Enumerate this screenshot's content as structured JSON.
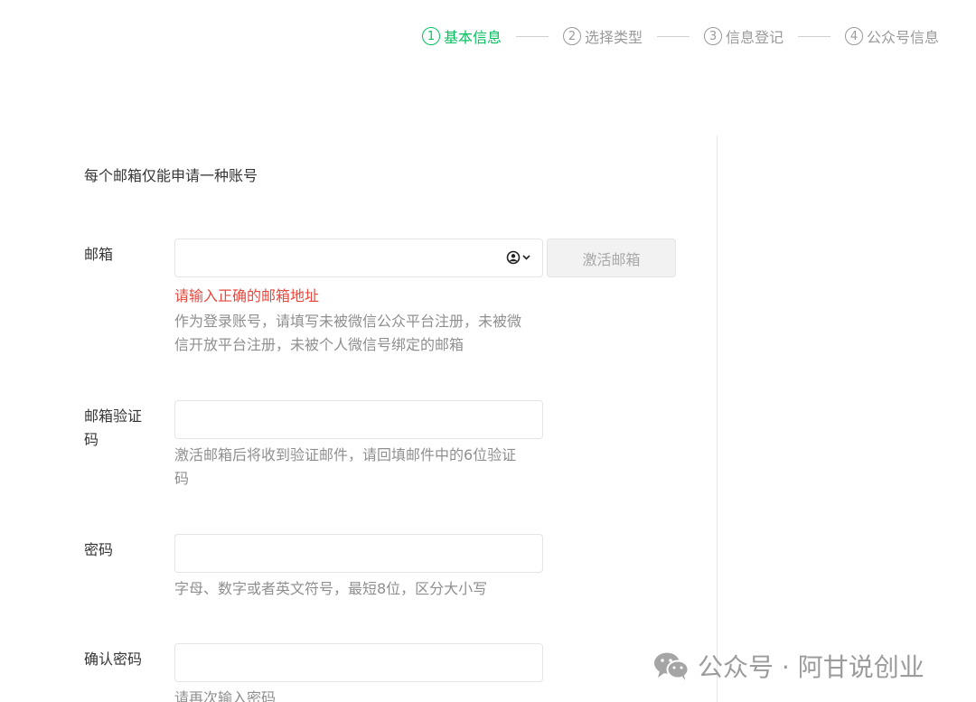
{
  "stepper": {
    "steps": [
      {
        "num": "1",
        "label": "基本信息",
        "active": true
      },
      {
        "num": "2",
        "label": "选择类型",
        "active": false
      },
      {
        "num": "3",
        "label": "信息登记",
        "active": false
      },
      {
        "num": "4",
        "label": "公众号信息",
        "active": false
      }
    ]
  },
  "notice": "每个邮箱仅能申请一种账号",
  "email": {
    "label": "邮箱",
    "value": "",
    "placeholder": "",
    "activate_button": "激活邮箱",
    "error": "请输入正确的邮箱地址",
    "tip": "作为登录账号，请填写未被微信公众平台注册，未被微信开放平台注册，未被个人微信号绑定的邮箱"
  },
  "verify_code": {
    "label": "邮箱验证码",
    "value": "",
    "tip": "激活邮箱后将收到验证邮件，请回填邮件中的6位验证码"
  },
  "password": {
    "label": "密码",
    "value": "",
    "tip": "字母、数字或者英文符号，最短8位，区分大小写"
  },
  "confirm_password": {
    "label": "确认密码",
    "value": "",
    "tip": "请再次输入密码"
  },
  "watermark": "公众号 · 阿甘说创业",
  "colors": {
    "accent": "#07c160",
    "error": "#e5493f",
    "tip": "#8f8f8f"
  }
}
